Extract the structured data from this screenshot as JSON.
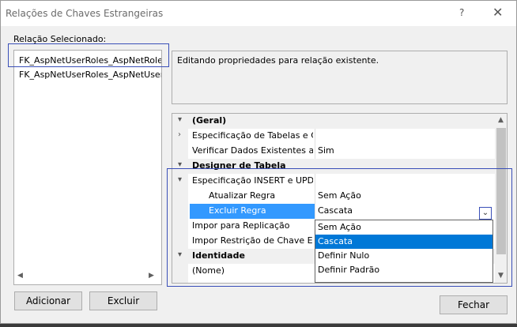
{
  "window": {
    "title": "Relações de Chaves Estrangeiras",
    "help_glyph": "?",
    "close_glyph": "✕"
  },
  "relations": {
    "label": "Relação Selecionado:",
    "items": [
      {
        "label": "FK_AspNetUserRoles_AspNetRoles_RoleId",
        "selected": true
      },
      {
        "label": "FK_AspNetUserRoles_AspNetUsers_UserId",
        "selected": false
      }
    ]
  },
  "buttons": {
    "add": "Adicionar",
    "delete": "Excluir",
    "close": "Fechar"
  },
  "description": "Editando propriedades para relação existente.",
  "properties": {
    "rows": [
      {
        "name": "(Geral)",
        "value": "",
        "category": true,
        "expander": "expanded"
      },
      {
        "name": "Especificação de Tabelas e Colunas",
        "value": "",
        "category": false,
        "expander": "collapsed"
      },
      {
        "name": "Verificar Dados Existentes ao Criar",
        "value": "Sim",
        "category": false,
        "expander": ""
      },
      {
        "name": "Designer de Tabela",
        "value": "",
        "category": true,
        "expander": "expanded"
      },
      {
        "name": "Especificação INSERT e UPDATE",
        "value": "",
        "category": false,
        "expander": "expanded"
      },
      {
        "name": "Atualizar Regra",
        "value": "Sem Ação",
        "category": false,
        "expander": "",
        "indent": true
      },
      {
        "name": "Excluir Regra",
        "value": "Cascata",
        "category": false,
        "expander": "",
        "indent": true,
        "selected": true
      },
      {
        "name": "Impor para Replicação",
        "value": "",
        "category": false,
        "expander": ""
      },
      {
        "name": "Impor Restrição de Chave Estrangeira",
        "value": "",
        "category": false,
        "expander": ""
      },
      {
        "name": "Identidade",
        "value": "",
        "category": true,
        "expander": "expanded"
      },
      {
        "name": "(Nome)",
        "value": "",
        "category": false,
        "expander": ""
      }
    ]
  },
  "dropdown": {
    "options": [
      "Sem Ação",
      "Cascata",
      "Definir Nulo",
      "Definir Padrão"
    ],
    "selected": "Cascata"
  },
  "icons": {
    "expanded": "chevron-down-icon",
    "collapsed": "chevron-right-icon"
  }
}
